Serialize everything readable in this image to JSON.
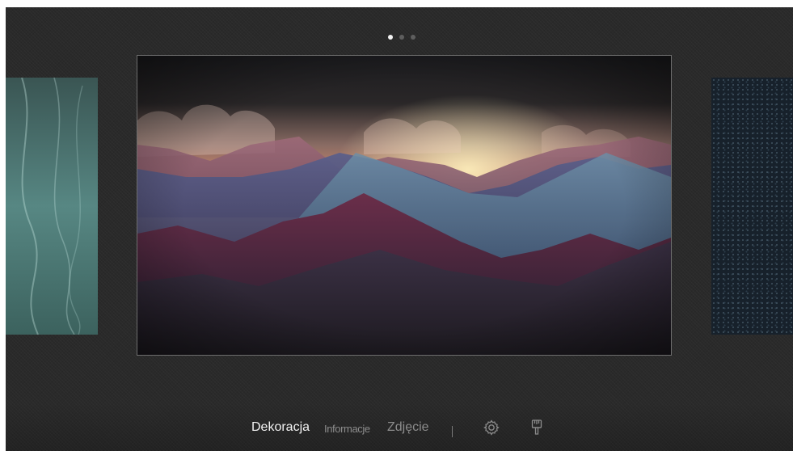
{
  "pagination": {
    "pages": 3,
    "current": 1
  },
  "artwork": {
    "subject": "mountains-at-dusk-painting"
  },
  "side_cards": {
    "left": "water-light-artwork",
    "right": "textured-pattern-artwork"
  },
  "menu": {
    "items": [
      {
        "label": "Dekoracja",
        "selected": true
      },
      {
        "label": "Informacje",
        "selected": false
      },
      {
        "label": "Zdjęcie",
        "selected": false
      }
    ],
    "icons": [
      "settings-icon",
      "brush-icon"
    ]
  },
  "colors": {
    "background": "#2a2a2a",
    "selected_text": "#f2f2f2",
    "unselected_text": "#8c8c8c",
    "frame_border": "#6d6d6d"
  }
}
